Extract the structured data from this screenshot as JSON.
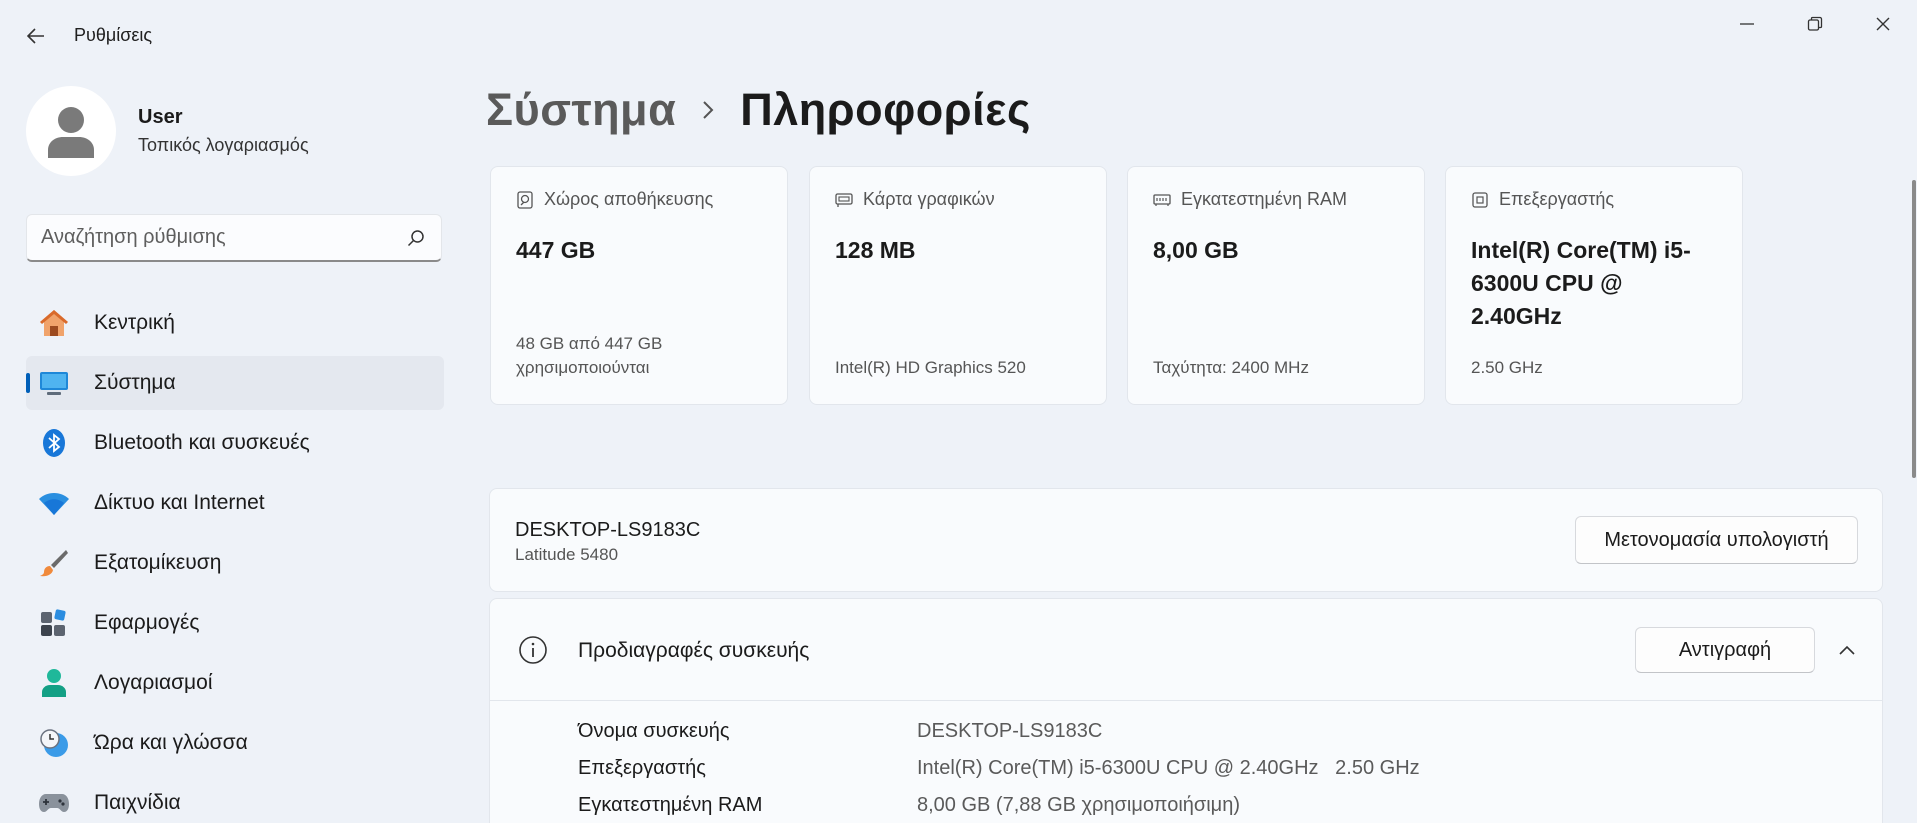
{
  "window": {
    "app_title": "Ρυθμίσεις"
  },
  "profile": {
    "name": "User",
    "account_type": "Τοπικός λογαριασμός"
  },
  "search": {
    "placeholder": "Αναζήτηση ρύθμισης"
  },
  "nav": {
    "items": [
      {
        "label": "Κεντρική",
        "icon": "home-icon"
      },
      {
        "label": "Σύστημα",
        "icon": "system-icon",
        "selected": true
      },
      {
        "label": "Bluetooth και συσκευές",
        "icon": "bluetooth-icon"
      },
      {
        "label": "Δίκτυο και Internet",
        "icon": "wifi-icon"
      },
      {
        "label": "Εξατομίκευση",
        "icon": "brush-icon"
      },
      {
        "label": "Εφαρμογές",
        "icon": "apps-icon"
      },
      {
        "label": "Λογαριασμοί",
        "icon": "person-icon"
      },
      {
        "label": "Ώρα και γλώσσα",
        "icon": "clock-globe-icon"
      },
      {
        "label": "Παιχνίδια",
        "icon": "gamepad-icon"
      }
    ]
  },
  "breadcrumb": {
    "parent": "Σύστημα",
    "current": "Πληροφορίες"
  },
  "cards": [
    {
      "title": "Χώρος αποθήκευσης",
      "icon": "storage-icon",
      "value": "447 GB",
      "sub": "48 GB από 447 GB χρησιμοποιούνται"
    },
    {
      "title": "Κάρτα γραφικών",
      "icon": "graphics-card-icon",
      "value": "128 MB",
      "sub": "Intel(R) HD Graphics 520"
    },
    {
      "title": "Εγκατεστημένη RAM",
      "icon": "ram-icon",
      "value": "8,00 GB",
      "sub": "Ταχύτητα: 2400 MHz"
    },
    {
      "title": "Επεξεργαστής",
      "icon": "processor-icon",
      "value": "Intel(R) Core(TM) i5-6300U CPU @ 2.40GHz",
      "sub": "2.50 GHz"
    }
  ],
  "device": {
    "name": "DESKTOP-LS9183C",
    "model": "Latitude 5480",
    "rename_label": "Μετονομασία υπολογιστή"
  },
  "specs": {
    "title": "Προδιαγραφές συσκευής",
    "copy_label": "Αντιγραφή",
    "rows": [
      {
        "label": "Όνομα συσκευής",
        "value": "DESKTOP-LS9183C"
      },
      {
        "label": "Επεξεργαστής",
        "value": "Intel(R) Core(TM) i5-6300U CPU @ 2.40GHz   2.50 GHz"
      },
      {
        "label": "Εγκατεστημένη RAM",
        "value": "8,00 GB (7,88 GB χρησιμοποιήσιμη)"
      }
    ]
  },
  "colors": {
    "accent": "#005fb8",
    "background": "#eef2f8",
    "card": "#f9fbfd"
  }
}
